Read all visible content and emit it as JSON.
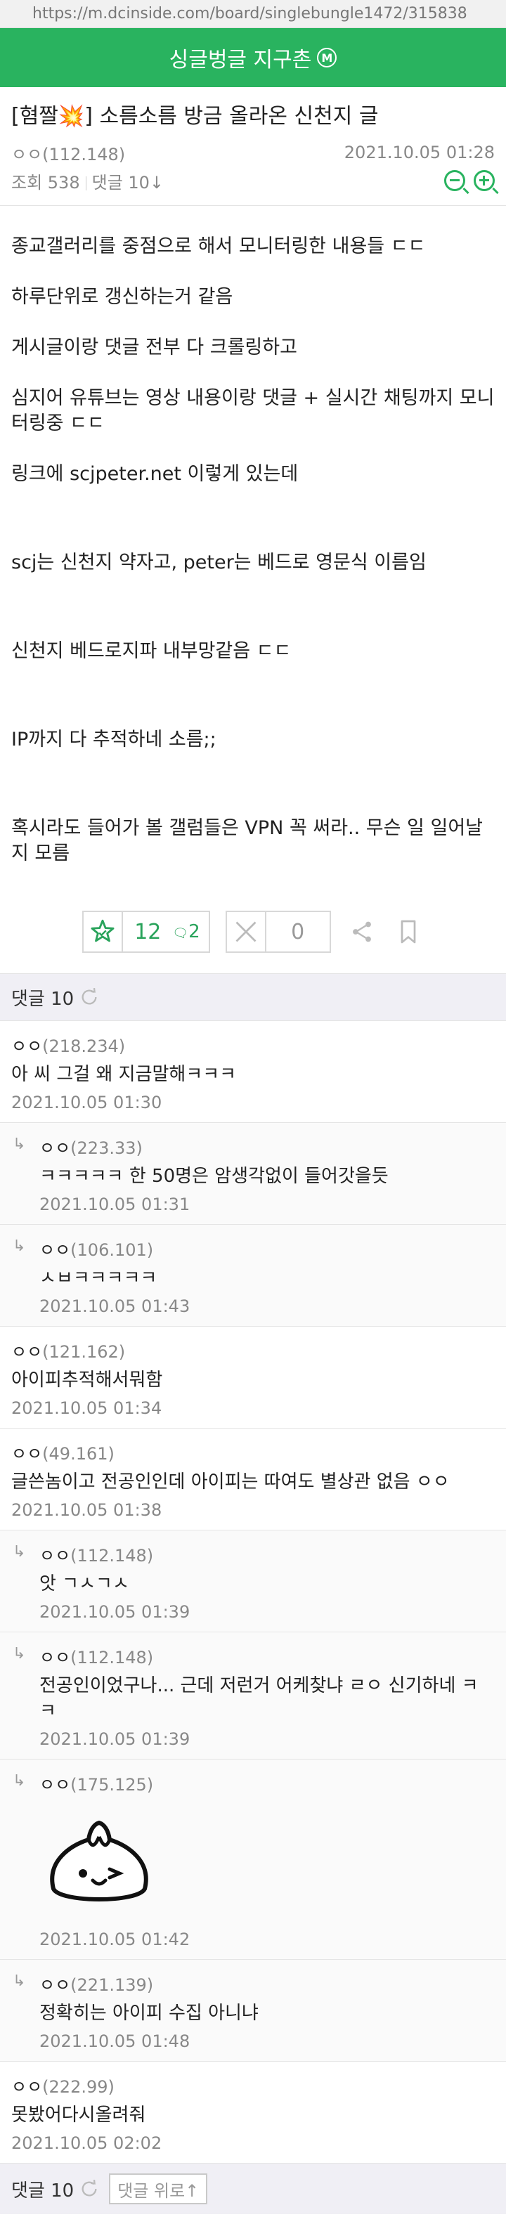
{
  "url": "https://m.dcinside.com/board/singlebungle1472/315838",
  "header": {
    "title": "싱글벙글 지구촌",
    "badge": "M"
  },
  "post": {
    "title": "[혐짤💥] 소름소름 방금 올라온 신천지 글",
    "author": "ㅇㅇ",
    "author_ip": "(112.148)",
    "datetime": "2021.10.05 01:28",
    "views": "조회 538",
    "comments_label": "댓글 10↓",
    "paragraphs": [
      "종교갤러리를 중점으로 해서 모니터링한 내용들 ㄷㄷ",
      "하루단위로 갱신하는거 같음",
      "게시글이랑 댓글 전부 다 크롤링하고",
      "심지어 유튜브는 영상 내용이랑 댓글 + 실시간 채팅까지 모니터링중 ㄷㄷ",
      "링크에 scjpeter.net 이렇게 있는데",
      "scj는 신천지 약자고, peter는 베드로 영문식 이름임",
      "신천지 베드로지파 내부망같음 ㄷㄷ",
      "IP까지 다 추적하네 소름;;",
      "혹시라도 들어가 볼 갤럼들은 VPN 꼭 써라.. 무슨 일 일어날지 모름"
    ]
  },
  "reco": {
    "up_count": "12",
    "fix_count": "2",
    "down_count": "0"
  },
  "comments_bar": {
    "label": "댓글 10"
  },
  "comments": [
    {
      "reply": false,
      "author": "ㅇㅇ",
      "ip": "(218.234)",
      "text": "아 씨 그걸 왜 지금말해ㅋㅋㅋ",
      "date": "2021.10.05 01:30"
    },
    {
      "reply": true,
      "author": "ㅇㅇ",
      "ip": "(223.33)",
      "text": "ㅋㅋㅋㅋㅋ 한 50명은 암생각없이 들어갓을듯",
      "date": "2021.10.05 01:31"
    },
    {
      "reply": true,
      "author": "ㅇㅇ",
      "ip": "(106.101)",
      "text": "ㅅㅂㅋㅋㅋㅋㅋ",
      "date": "2021.10.05 01:43"
    },
    {
      "reply": false,
      "author": "ㅇㅇ",
      "ip": "(121.162)",
      "text": "아이피추적해서뭐함",
      "date": "2021.10.05 01:34"
    },
    {
      "reply": false,
      "author": "ㅇㅇ",
      "ip": "(49.161)",
      "text": "글쓴놈이고 전공인인데 아이피는 따여도 별상관 없음 ㅇㅇ",
      "date": "2021.10.05 01:38"
    },
    {
      "reply": true,
      "author": "ㅇㅇ",
      "ip": "(112.148)",
      "text": "앗 ㄱㅅㄱㅅ",
      "date": "2021.10.05 01:39"
    },
    {
      "reply": true,
      "author": "ㅇㅇ",
      "ip": "(112.148)",
      "text": "전공인이었구나... 근데 저런거 어케찾냐 ㄹㅇ 신기하네 ㅋㅋ",
      "date": "2021.10.05 01:39"
    },
    {
      "reply": true,
      "author": "ㅇㅇ",
      "ip": "(175.125)",
      "text": "",
      "date": "2021.10.05 01:42",
      "dccon": true
    },
    {
      "reply": true,
      "author": "ㅇㅇ",
      "ip": "(221.139)",
      "text": "정확히는 아이피 수집 아니냐",
      "date": "2021.10.05 01:48"
    },
    {
      "reply": false,
      "author": "ㅇㅇ",
      "ip": "(222.99)",
      "text": "못봤어다시올려줘",
      "date": "2021.10.05 02:02"
    }
  ],
  "bottom": {
    "label": "댓글 10",
    "up_button": "댓글 위로↑"
  },
  "colors": {
    "brand": "#29b35f",
    "reco": "#29a35b"
  }
}
